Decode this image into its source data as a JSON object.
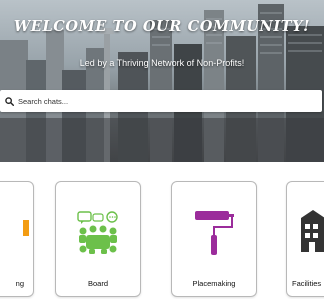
{
  "hero": {
    "title": "WELCOME TO OUR COMMUNITY!",
    "subtitle": "Led by a Thriving Network of Non-Profits!"
  },
  "search": {
    "placeholder": "Search chats..."
  },
  "cards": [
    {
      "label": "ng",
      "icon": "partial-card-icon"
    },
    {
      "label": "Board",
      "icon": "board-meeting-icon"
    },
    {
      "label": "Placemaking",
      "icon": "paint-roller-icon"
    },
    {
      "label": "Facilities",
      "icon": "building-icon"
    }
  ],
  "colors": {
    "board_green": "#6cc04a",
    "roller_purple": "#9b2c9b",
    "accent_orange": "#f39c12",
    "card_border": "#b8b8b8"
  }
}
